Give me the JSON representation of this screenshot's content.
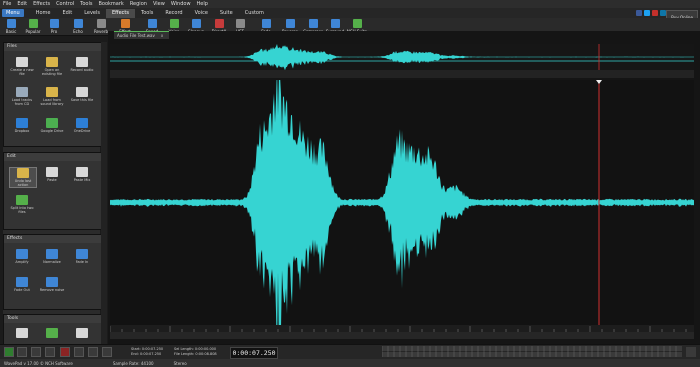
{
  "menubar": {
    "items": [
      "File",
      "Edit",
      "Effects",
      "Control",
      "Tools",
      "Bookmark",
      "Region",
      "View",
      "Window",
      "Help"
    ]
  },
  "ribbon": {
    "menu_label": "Menu",
    "tabs": [
      "Home",
      "Edit",
      "Levels",
      "Effects",
      "Tools",
      "Record",
      "Voice",
      "Suite",
      "Custom"
    ],
    "active_tab": "Effects",
    "buy_online": "Buy Online"
  },
  "toolbar": {
    "buttons": [
      {
        "label": "Basic",
        "icon": "sliders-icon",
        "color": "#3f86d6"
      },
      {
        "label": "Popular",
        "icon": "star-icon",
        "color": "#55b04a"
      },
      {
        "label": "Pro",
        "icon": "waveform-icon",
        "color": "#3f86d6"
      },
      {
        "label": "Echo",
        "icon": "echo-icon",
        "color": "#3f86d6"
      },
      {
        "label": "Reverb",
        "icon": "reverb-icon",
        "color": "#8a8a8a"
      },
      {
        "label": "Effect Chain",
        "icon": "chain-icon",
        "color": "#d87b2a"
      },
      {
        "label": "Speed",
        "icon": "speed-icon",
        "color": "#3f86d6"
      },
      {
        "label": "Voice",
        "icon": "voice-icon",
        "color": "#55b04a"
      },
      {
        "label": "Cleanup",
        "icon": "cleanup-icon",
        "color": "#3f86d6"
      },
      {
        "label": "DirectX",
        "icon": "directx-icon",
        "color": "#c63b3b"
      },
      {
        "label": "VST",
        "icon": "vst-icon",
        "color": "#8a8a8a"
      },
      {
        "label": "Fade",
        "icon": "fade-icon",
        "color": "#3f86d6"
      },
      {
        "label": "Reverse",
        "icon": "reverse-icon",
        "color": "#3f86d6"
      },
      {
        "label": "Compress",
        "icon": "compress-icon",
        "color": "#3f86d6"
      },
      {
        "label": "Surround",
        "icon": "surround-icon",
        "color": "#3f86d6"
      },
      {
        "label": "NCH Suite",
        "icon": "nch-suite-icon",
        "color": "#55b04a"
      }
    ]
  },
  "file_tab": {
    "name": "Audio File Test.wav",
    "close": "x"
  },
  "sidebar": {
    "files_title": "Files",
    "files": [
      {
        "label": "Create a new file",
        "icon": "new-file-icon",
        "color": "#d8d8d8"
      },
      {
        "label": "Open an existing file",
        "icon": "open-file-icon",
        "color": "#d9b44a"
      },
      {
        "label": "Record audio",
        "icon": "record-icon",
        "color": "#d8d8d8"
      },
      {
        "label": "Load tracks from CD",
        "icon": "cd-icon",
        "color": "#9ab"
      },
      {
        "label": "Load from sound library",
        "icon": "library-icon",
        "color": "#d9b44a"
      },
      {
        "label": "Save this file",
        "icon": "save-icon",
        "color": "#d8d8d8"
      },
      {
        "label": "Dropbox",
        "icon": "dropbox-icon",
        "color": "#2d7fd6"
      },
      {
        "label": "Google Drive",
        "icon": "google-drive-icon",
        "color": "#4caf50"
      },
      {
        "label": "OneDrive",
        "icon": "onedrive-icon",
        "color": "#2d7fd6"
      }
    ],
    "edit_title": "Edit",
    "edit": [
      {
        "label": "Undo last action",
        "icon": "undo-icon",
        "color": "#d9b44a"
      },
      {
        "label": "Paste",
        "icon": "paste-icon",
        "color": "#d8d8d8"
      },
      {
        "label": "Paste Mix",
        "icon": "paste-mix-icon",
        "color": "#d8d8d8"
      },
      {
        "label": "Split into two files",
        "icon": "split-icon",
        "color": "#55b04a"
      }
    ],
    "effects_title": "Effects",
    "effects": [
      {
        "label": "Amplify",
        "icon": "amplify-icon",
        "color": "#3f86d6"
      },
      {
        "label": "Normalize",
        "icon": "normalize-icon",
        "color": "#3f86d6"
      },
      {
        "label": "Fade In",
        "icon": "fade-in-icon",
        "color": "#3f86d6"
      },
      {
        "label": "Fade Out",
        "icon": "fade-out-icon",
        "color": "#3f86d6"
      },
      {
        "label": "Remove noise",
        "icon": "remove-noise-icon",
        "color": "#3f86d6"
      }
    ],
    "tools_title": "Tools"
  },
  "bottom": {
    "start_label": "Start:",
    "start_value": "0:00:07.250",
    "end_label": "End:",
    "end_value": "0:00:07.250",
    "sel_length_label": "Sel Length:",
    "sel_length_value": "0:00:00.000",
    "file_length_label": "File Length:",
    "file_length_value": "0:00:08.808",
    "current_time": "0:00:07.250"
  },
  "status": {
    "app": "WavePad v 17.00 © NCH Software",
    "sample_rate": "Sample Rate: 44100",
    "channels": "Stereo"
  },
  "colors": {
    "waveform": "#36d4d2",
    "cursor": "#d03030",
    "background": "#151515"
  }
}
